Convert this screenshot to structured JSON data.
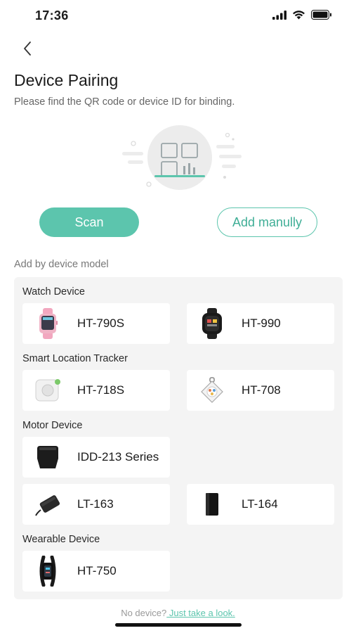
{
  "status_bar": {
    "time": "17:36"
  },
  "header": {
    "title": "Device Pairing",
    "subtitle": "Please find the QR code or device ID for binding."
  },
  "actions": {
    "scan_label": "Scan",
    "manual_label": "Add manully"
  },
  "models": {
    "section_label": "Add by device model",
    "groups": [
      {
        "title": "Watch Device",
        "items": [
          {
            "name": "HT-790S",
            "icon": "pink-smartwatch-icon"
          },
          {
            "name": "HT-990",
            "icon": "black-smartwatch-icon"
          }
        ]
      },
      {
        "title": "Smart Location Tracker",
        "items": [
          {
            "name": "HT-718S",
            "icon": "white-tracker-icon"
          },
          {
            "name": "HT-708",
            "icon": "pendant-tracker-icon"
          }
        ]
      },
      {
        "title": "Motor Device",
        "items": [
          {
            "name": "IDD-213 Series",
            "icon": "obd-dongle-icon"
          },
          {
            "name": "LT-163",
            "icon": "car-tracker-icon"
          },
          {
            "name": "LT-164",
            "icon": "black-box-tracker-icon"
          }
        ]
      },
      {
        "title": "Wearable Device",
        "items": [
          {
            "name": "HT-750",
            "icon": "fitness-band-icon"
          }
        ]
      }
    ]
  },
  "footer": {
    "prefix": "No device?",
    "link": " Just take a look."
  },
  "colors": {
    "accent": "#5cc5ad",
    "panel": "#f4f4f4"
  }
}
